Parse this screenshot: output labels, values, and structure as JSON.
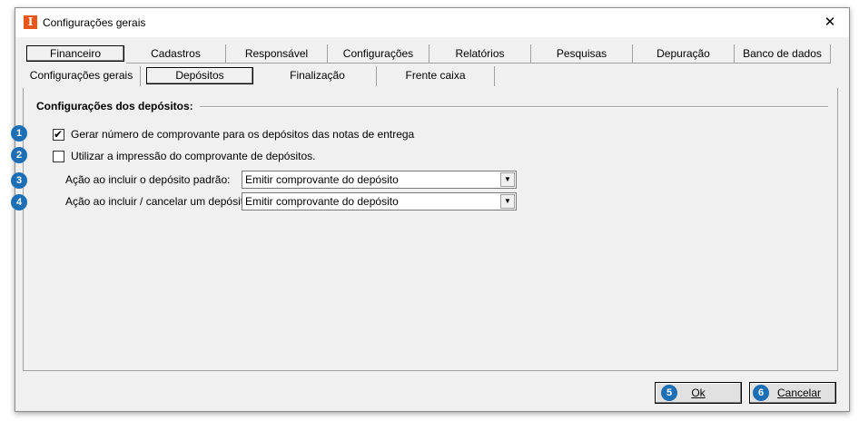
{
  "window": {
    "title": "Configurações gerais",
    "app_icon_letter": "I",
    "close_glyph": "✕"
  },
  "tabs_main": [
    "Financeiro",
    "Cadastros",
    "Responsável",
    "Configurações",
    "Relatórios",
    "Pesquisas",
    "Depuração",
    "Banco de dados"
  ],
  "tabs_sub": [
    "Configurações gerais",
    "Depósitos",
    "Finalização",
    "Frente caixa"
  ],
  "active_main_tab": "Financeiro",
  "active_sub_tab": "Depósitos",
  "group": {
    "title": "Configurações dos depósitos:"
  },
  "options": {
    "gerar_numero": {
      "badge": "1",
      "label": "Gerar número de comprovante para os depósitos das notas de entrega",
      "checked": true
    },
    "utilizar_impressao": {
      "badge": "2",
      "label": "Utilizar a impressão do comprovante de depósitos.",
      "checked": false
    }
  },
  "fields": {
    "acao_padrao": {
      "badge": "3",
      "label": "Ação ao incluir o depósito padrão:",
      "value": "Emitir comprovante do depósito"
    },
    "acao_cancelar": {
      "badge": "4",
      "label": "Ação ao incluir / cancelar um depósito:",
      "value": "Emitir comprovante do depósito"
    }
  },
  "buttons": {
    "ok": {
      "badge": "5",
      "label": "Ok"
    },
    "cancelar": {
      "badge": "6",
      "label": "Cancelar"
    }
  },
  "icons": {
    "check": "✔",
    "dropdown": "▼"
  },
  "colors": {
    "badge": "#1d6fb5",
    "app_icon": "#e8561b"
  }
}
